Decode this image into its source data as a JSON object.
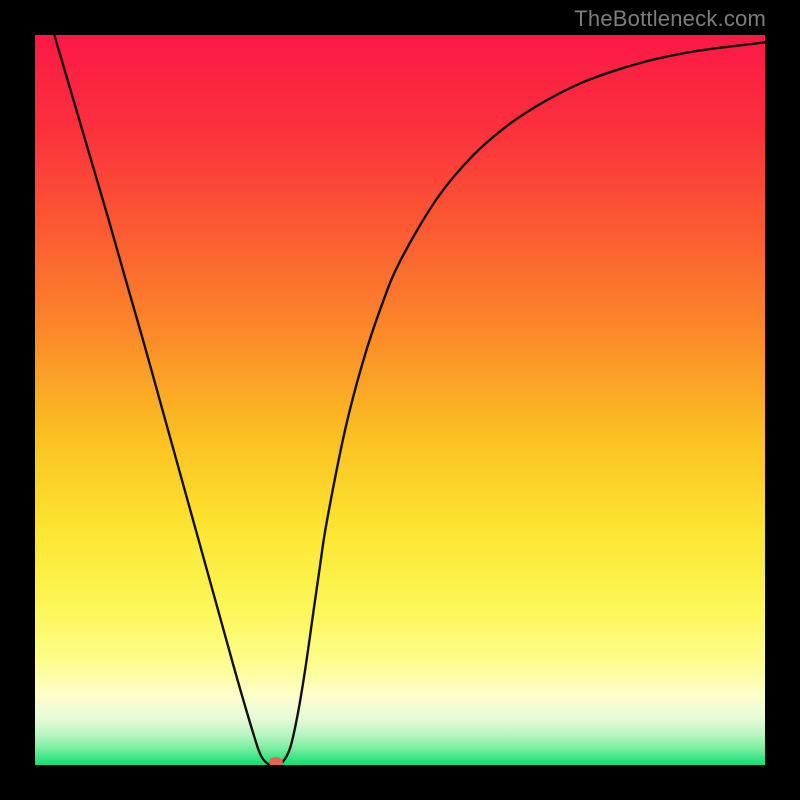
{
  "watermark": "TheBottleneck.com",
  "chart_data": {
    "type": "line",
    "title": "",
    "xlabel": "",
    "ylabel": "",
    "xlim": [
      0,
      1
    ],
    "ylim": [
      0,
      1
    ],
    "x": [
      0.0,
      0.025,
      0.05,
      0.075,
      0.1,
      0.125,
      0.15,
      0.175,
      0.2,
      0.225,
      0.25,
      0.275,
      0.3,
      0.31,
      0.32,
      0.33,
      0.34,
      0.35,
      0.36,
      0.37,
      0.38,
      0.39,
      0.4,
      0.425,
      0.45,
      0.475,
      0.5,
      0.55,
      0.6,
      0.65,
      0.7,
      0.75,
      0.8,
      0.85,
      0.9,
      0.95,
      1.0
    ],
    "y": [
      1.09,
      1.005,
      0.92,
      0.835,
      0.75,
      0.662,
      0.575,
      0.485,
      0.395,
      0.305,
      0.215,
      0.125,
      0.04,
      0.012,
      0.001,
      0.0,
      0.005,
      0.025,
      0.07,
      0.13,
      0.2,
      0.27,
      0.335,
      0.46,
      0.555,
      0.63,
      0.69,
      0.775,
      0.835,
      0.878,
      0.91,
      0.935,
      0.953,
      0.967,
      0.977,
      0.984,
      0.99
    ],
    "marker": {
      "x": 0.33,
      "y": 0.004
    },
    "background_gradient": {
      "stops": [
        {
          "offset": 0.0,
          "color": "#fb1945"
        },
        {
          "offset": 0.12,
          "color": "#fb2f3d"
        },
        {
          "offset": 0.25,
          "color": "#fb5533"
        },
        {
          "offset": 0.4,
          "color": "#fb862a"
        },
        {
          "offset": 0.55,
          "color": "#fbc022"
        },
        {
          "offset": 0.68,
          "color": "#fce631"
        },
        {
          "offset": 0.79,
          "color": "#fdf75a"
        },
        {
          "offset": 0.86,
          "color": "#fdfd8e"
        },
        {
          "offset": 0.905,
          "color": "#fefecb"
        },
        {
          "offset": 0.935,
          "color": "#e7fbd8"
        },
        {
          "offset": 0.958,
          "color": "#b9f5c2"
        },
        {
          "offset": 0.976,
          "color": "#80eea2"
        },
        {
          "offset": 0.99,
          "color": "#3ce585"
        },
        {
          "offset": 1.0,
          "color": "#0fe077"
        }
      ]
    },
    "marker_color": "#e26551",
    "curve_color": "#111111"
  }
}
